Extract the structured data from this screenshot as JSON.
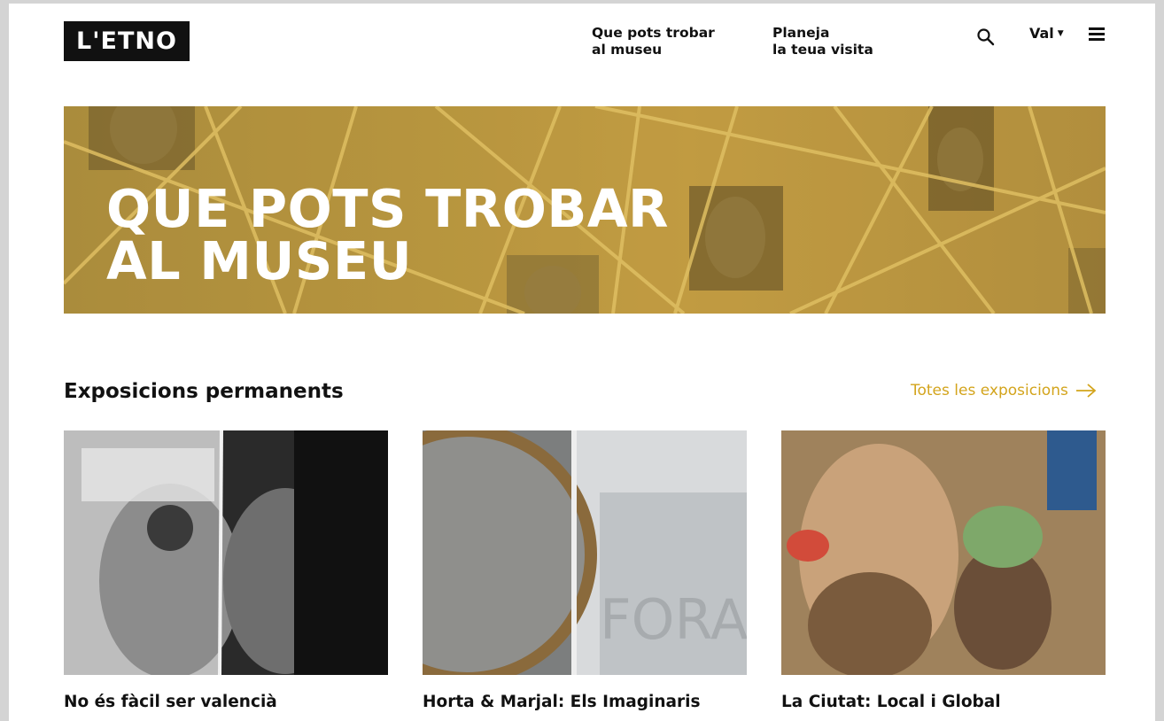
{
  "header": {
    "logo_text": "L'ETNO",
    "nav": [
      {
        "line1": "Que pots trobar",
        "line2": "al museu"
      },
      {
        "line1": "Planeja",
        "line2": "la teua visita"
      }
    ],
    "language": "Val",
    "icons": {
      "search": "search-icon",
      "menu": "hamburger-menu-icon",
      "language_caret": "caret-down-icon"
    }
  },
  "hero": {
    "title_line1": "QUE POTS TROBAR",
    "title_line2": "AL MUSEU",
    "overlay_color": "#b8973f"
  },
  "section": {
    "title": "Exposicions permanents",
    "all_link": "Totes les exposicions",
    "link_color": "#d3a41c",
    "cards": [
      {
        "title": "No és fàcil ser valencià"
      },
      {
        "title": "Horta & Marjal: Els Imaginaris"
      },
      {
        "title": "La Ciutat: Local i Global"
      }
    ]
  }
}
